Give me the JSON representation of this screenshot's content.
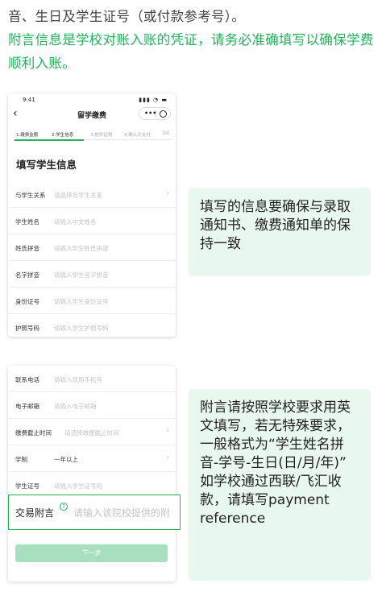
{
  "intro": {
    "line1": "音、生日及学生证号（或付款参考号）。",
    "green": "附言信息是学校对账入账的凭证，请务必准确填写以确保学费顺利入账。"
  },
  "phone": {
    "time": "9:41",
    "status_icons": "▮▮▮ ◔ ▬",
    "back_label": "‹",
    "title": "留学缴费",
    "capsule_dots": "•••",
    "steps": [
      "1.缴费金额",
      "2.学生信息",
      "3.提供证明",
      "4.确认并支付",
      "2/4"
    ],
    "section_title": "填写学生信息",
    "rows_top": [
      {
        "label": "与学生关系",
        "placeholder": "请选择与学生关系",
        "chevron": "›"
      },
      {
        "label": "学生姓名",
        "placeholder": "请输入中文姓名"
      },
      {
        "label": "姓氏拼音",
        "placeholder": "请输入学生姓氏拼音"
      },
      {
        "label": "名字拼音",
        "placeholder": "请输入学生名字拼音"
      },
      {
        "label": "身份证号",
        "placeholder": "请输入学生身份证号"
      },
      {
        "label": "护照号码",
        "placeholder": "请输入学生护照号码"
      }
    ],
    "rows_bottom": [
      {
        "label": "联系电话",
        "placeholder": "请输入现用手机号"
      },
      {
        "label": "电子邮箱",
        "placeholder": "请输入电子邮箱"
      },
      {
        "label": "缴费截止时间",
        "placeholder": "请选择缴费截止时间",
        "chevron": "›"
      },
      {
        "label": "学制",
        "value": "一年以上",
        "chevron": "›"
      },
      {
        "label": "学生证号",
        "placeholder": "请输入学生证号码"
      }
    ],
    "memo": {
      "label": "交易附言",
      "help": "?",
      "placeholder": "请输入该院校提供的附"
    },
    "next_button": "下一步"
  },
  "bubbles": {
    "b1": "填写的信息要确保与录取通知书、缴费通知单的保持一致",
    "b2_line1": "附言请按照学校要求用英文填写，若无特殊要求，一般格式为“学生姓名拼音-学号-生日(日/月/年)”",
    "b2_line2": "如学校通过西联/飞汇收款，请填写payment reference"
  },
  "colors": {
    "accent": "#1fb35a",
    "bubble_bg": "#e9f8ee",
    "button_disabled": "#a8dfbf"
  }
}
